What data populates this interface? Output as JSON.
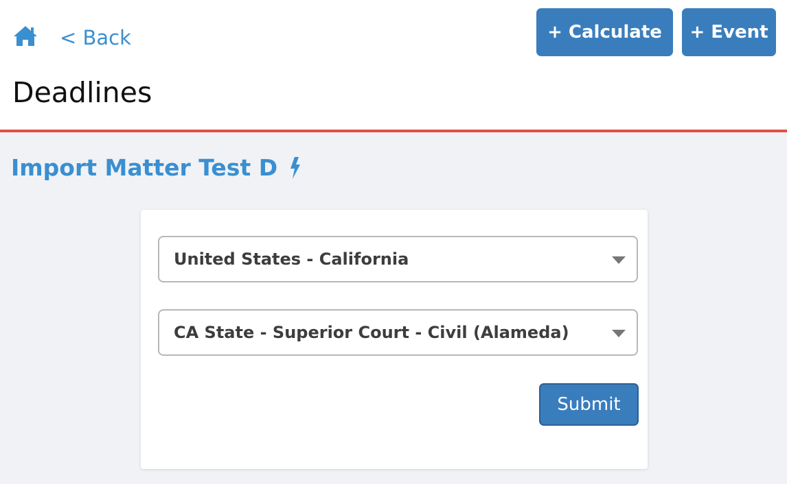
{
  "header": {
    "back_label": "< Back",
    "calculate_label": "+ Calculate",
    "event_label": "+ Event",
    "page_title": "Deadlines"
  },
  "matter": {
    "title": "Import Matter Test D"
  },
  "form": {
    "jurisdiction_value": "United States - California",
    "court_value": "CA State - Superior Court - Civil (Alameda)",
    "submit_label": "Submit"
  },
  "icons": {
    "home": "home-icon",
    "bolt": "lightning-bolt-icon",
    "caret": "caret-down-icon"
  },
  "colors": {
    "accent_blue": "#3a8fd0",
    "button_blue": "#3a7dbd",
    "divider_red": "#e05243",
    "page_background": "#f0f2f6"
  }
}
